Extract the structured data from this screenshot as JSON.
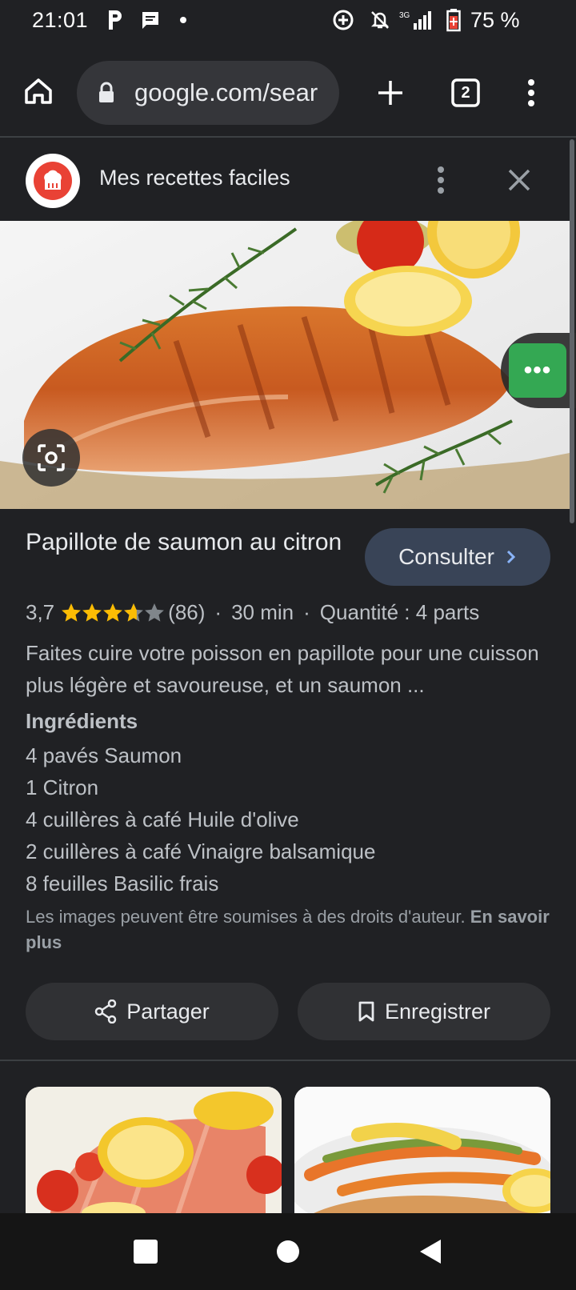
{
  "status_bar": {
    "time": "21:01",
    "battery_percent": "75 %",
    "network": "3G",
    "icons": [
      "parking-icon",
      "message-icon",
      "dot-icon",
      "data-saver-icon",
      "bell-off-icon",
      "signal-icon",
      "battery-icon"
    ]
  },
  "browser": {
    "url": "google.com/sear",
    "tab_count": "2",
    "icons": [
      "home-icon",
      "lock-icon",
      "plus-icon",
      "tabs-icon",
      "more-vert-icon"
    ]
  },
  "source": {
    "name": "Mes recettes faciles"
  },
  "recipe": {
    "title": "Papillote de saumon au citron",
    "consult_label": "Consulter",
    "rating": "3,7",
    "rating_value": 3.7,
    "rating_max": 5,
    "reviews": "(86)",
    "sep": "·",
    "time": "30 min",
    "quantity": "Quantité : 4 parts",
    "description": "Faites cuire votre poisson en papillote pour une cuisson plus légère et savoureuse, et un saumon ...",
    "ingredients_title": "Ingrédients",
    "ingredients": [
      "4 pavés Saumon",
      "1 Citron",
      "4 cuillères à café Huile d'olive",
      "2 cuillères à café Vinaigre balsamique",
      "8 feuilles Basilic frais"
    ],
    "copyright_text": "Les images peuvent être soumises à des droits d'auteur.",
    "learn_more": "En savoir plus"
  },
  "actions": {
    "share_label": "Partager",
    "save_label": "Enregistrer"
  },
  "floating": {
    "dots": "•••"
  },
  "colors": {
    "background": "#202124",
    "consult_button": "#394457",
    "action_button": "#303134",
    "star": "#fbbc04",
    "green_badge": "#34a853"
  }
}
